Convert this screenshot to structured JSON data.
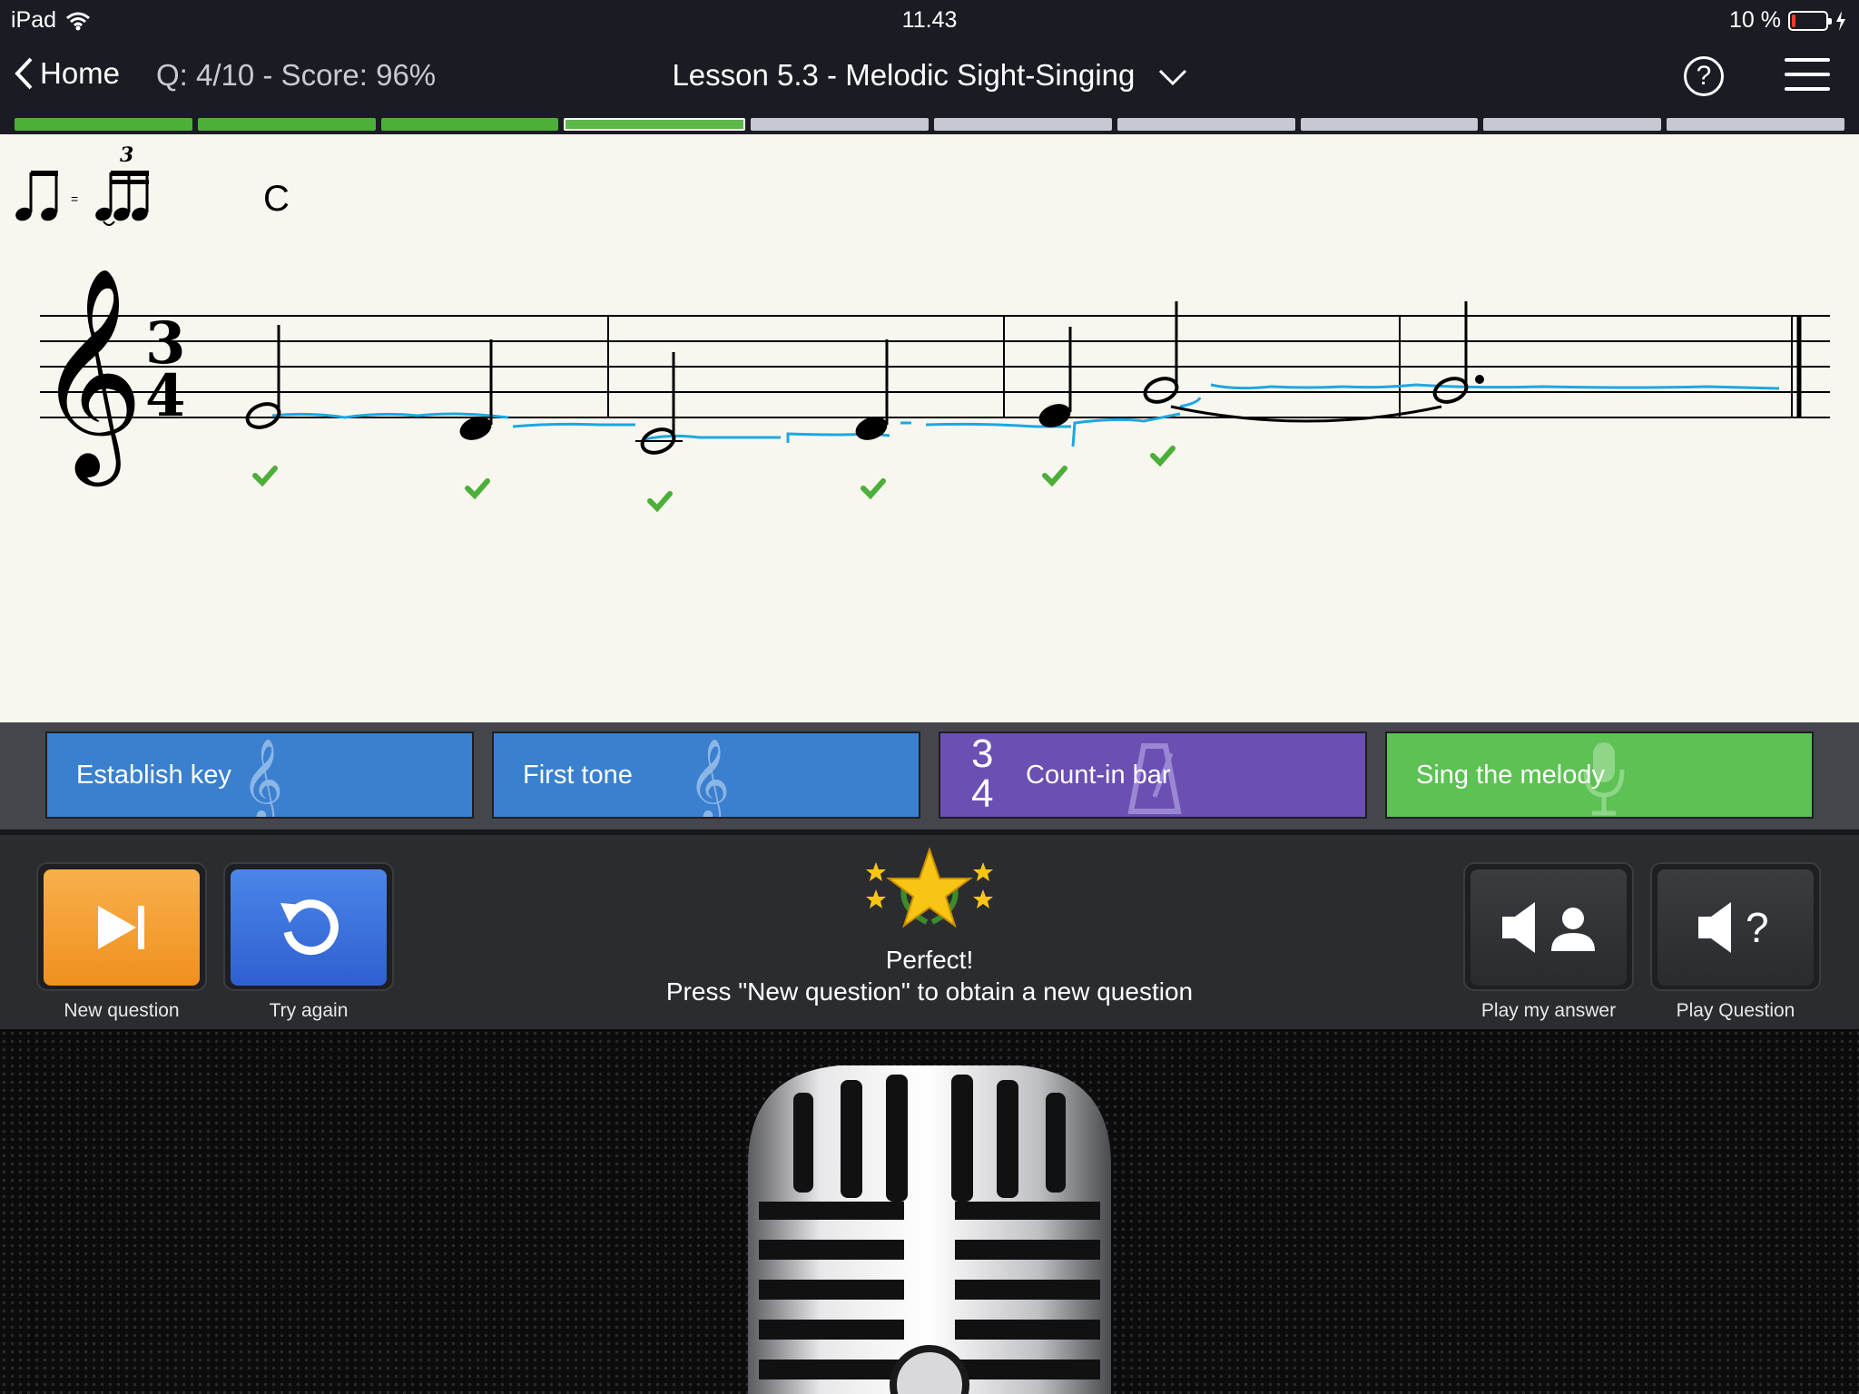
{
  "status_bar": {
    "device": "iPad",
    "time": "11.43",
    "battery": "10 %",
    "battery_level": 0.1
  },
  "nav": {
    "back_label": "Home",
    "score": "Q: 4/10 - Score: 96%",
    "title": "Lesson 5.3 - Melodic Sight-Singing",
    "help_icon": "question-circle-icon",
    "menu_icon": "hamburger-menu-icon"
  },
  "progress": {
    "total": 10,
    "completed": 3,
    "current": 4
  },
  "score_sheet": {
    "tempo_equation": "=",
    "triplet_number": "3",
    "chord": "C",
    "time_signature": {
      "top": "3",
      "bottom": "4"
    }
  },
  "step_buttons": [
    {
      "label": "Establish key",
      "icon": "treble-clef-icon",
      "color": "#3b80cf"
    },
    {
      "label": "First tone",
      "icon": "treble-clef-icon",
      "color": "#3b80cf"
    },
    {
      "label": "Count-in bar",
      "icon": "metronome-icon",
      "color": "#6b4fb3",
      "sig_top": "3",
      "sig_bottom": "4"
    },
    {
      "label": "Sing the melody",
      "icon": "microphone-icon",
      "color": "#5dc154"
    }
  ],
  "controls": {
    "new_question": "New question",
    "try_again": "Try again",
    "play_my_answer": "Play my answer",
    "play_question": "Play Question"
  },
  "feedback": {
    "title": "Perfect!",
    "message": "Press \"New question\" to obtain a new question"
  },
  "colors": {
    "accent_green": "#4caf3a",
    "accent_orange": "#f49a2c",
    "accent_blue": "#3b6fd9",
    "pitch_trace": "#1ea7e1"
  }
}
